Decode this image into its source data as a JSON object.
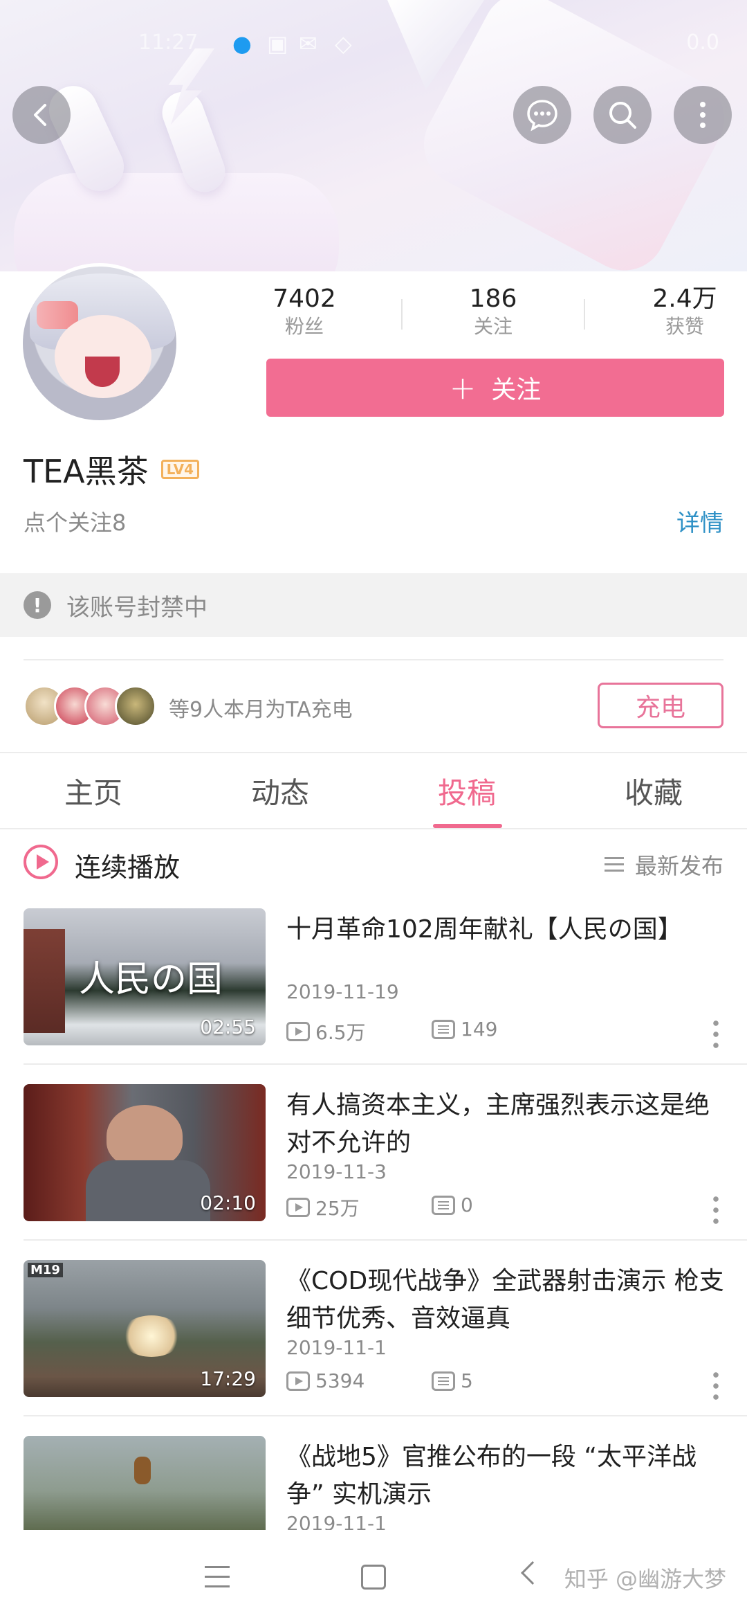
{
  "status_bar": {
    "time": "11:27",
    "right": "0.0"
  },
  "header": {
    "back_icon": "back-arrow-icon",
    "message_icon": "message-icon",
    "search_icon": "search-icon",
    "more_icon": "more-vertical-icon"
  },
  "profile": {
    "stats": [
      {
        "value": "7402",
        "label": "粉丝"
      },
      {
        "value": "186",
        "label": "关注"
      },
      {
        "value": "2.4万",
        "label": "获赞"
      }
    ],
    "follow_button": {
      "plus": "+",
      "label": "关注"
    },
    "username": "TEA黑茶",
    "level_badge": "LV4",
    "signature": "点个关注8",
    "detail_link": "详情",
    "level_color": "#f3b15b"
  },
  "banned_notice": {
    "icon": "!",
    "text": "该账号封禁中"
  },
  "charge": {
    "text": "等9人本月为TA充电",
    "button": "充电"
  },
  "tabs": [
    {
      "label": "主页",
      "active": false
    },
    {
      "label": "动态",
      "active": false
    },
    {
      "label": "投稿",
      "active": true
    },
    {
      "label": "收藏",
      "active": false
    }
  ],
  "playlist": {
    "label": "连续播放",
    "sort_label": "最新发布"
  },
  "videos": [
    {
      "title": "十月革命102周年献礼【人民の国】",
      "thumb_text": "人民の国",
      "duration": "02:55",
      "date": "2019-11-19",
      "views": "6.5万",
      "comments": "149"
    },
    {
      "title": "有人搞资本主义，主席强烈表示这是绝对不允许的",
      "thumb_text": "",
      "duration": "02:10",
      "date": "2019-11-3",
      "views": "25万",
      "comments": "0"
    },
    {
      "title": "《COD现代战争》全武器射击演示 枪支细节优秀、音效逼真",
      "thumb_tag": "M19",
      "duration": "17:29",
      "date": "2019-11-1",
      "views": "5394",
      "comments": "5"
    },
    {
      "title": "《战地5》官推公布的一段 “太平洋战争” 实机演示",
      "date": "2019-11-1"
    }
  ],
  "accent_color": "#f0698e",
  "watermark": "知乎 @幽游大梦"
}
